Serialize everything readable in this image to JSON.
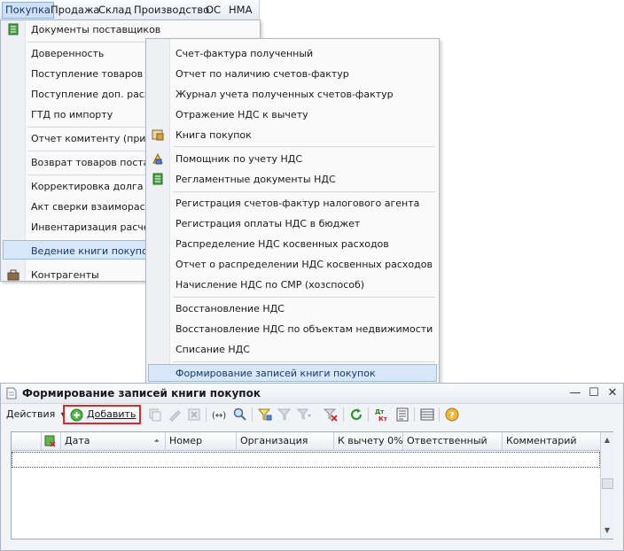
{
  "menubar": {
    "items": [
      "Покупка",
      "Продажа",
      "Склад",
      "Производство",
      "ОС",
      "НМА"
    ]
  },
  "menu1": {
    "items": [
      "Документы поставщиков",
      "Доверенность",
      "Поступление товаров и у",
      "Поступление доп. расходо",
      "ГТД по импорту",
      "Отчет комитенту (принци",
      "Возврат товаров поставщ",
      "Корректировка долга",
      "Акт сверки взаиморасчет",
      "Инвентаризация расчетов",
      "Ведение книги покупок",
      "Контрагенты"
    ]
  },
  "menu2": {
    "items": [
      "Счет-фактура полученный",
      "Отчет по наличию счетов-фактур",
      "Журнал учета полученных счетов-фактур",
      "Отражение НДС к вычету",
      "Книга покупок",
      "Помощник по учету НДС",
      "Регламентные документы НДС",
      "Регистрация счетов-фактур налогового агента",
      "Регистрация оплаты НДС в бюджет",
      "Распределение НДС косвенных расходов",
      "Отчет о распределении НДС косвенных расходов",
      "Начисление НДС по СМР (хозспособ)",
      "Восстановление НДС",
      "Восстановление НДС по объектам недвижимости",
      "Списание НДС",
      "Формирование записей книги покупок"
    ]
  },
  "form": {
    "title": "Формирование записей книги покупок",
    "toolbar": {
      "actions_label": "Действия",
      "add_label": "Добавить"
    },
    "columns": [
      "Дата",
      "Номер",
      "Организация",
      "К вычету 0%",
      "Ответственный",
      "Комментарий"
    ]
  },
  "colors": {
    "highlight": "#d7e6f8",
    "add_border": "#e02828"
  }
}
